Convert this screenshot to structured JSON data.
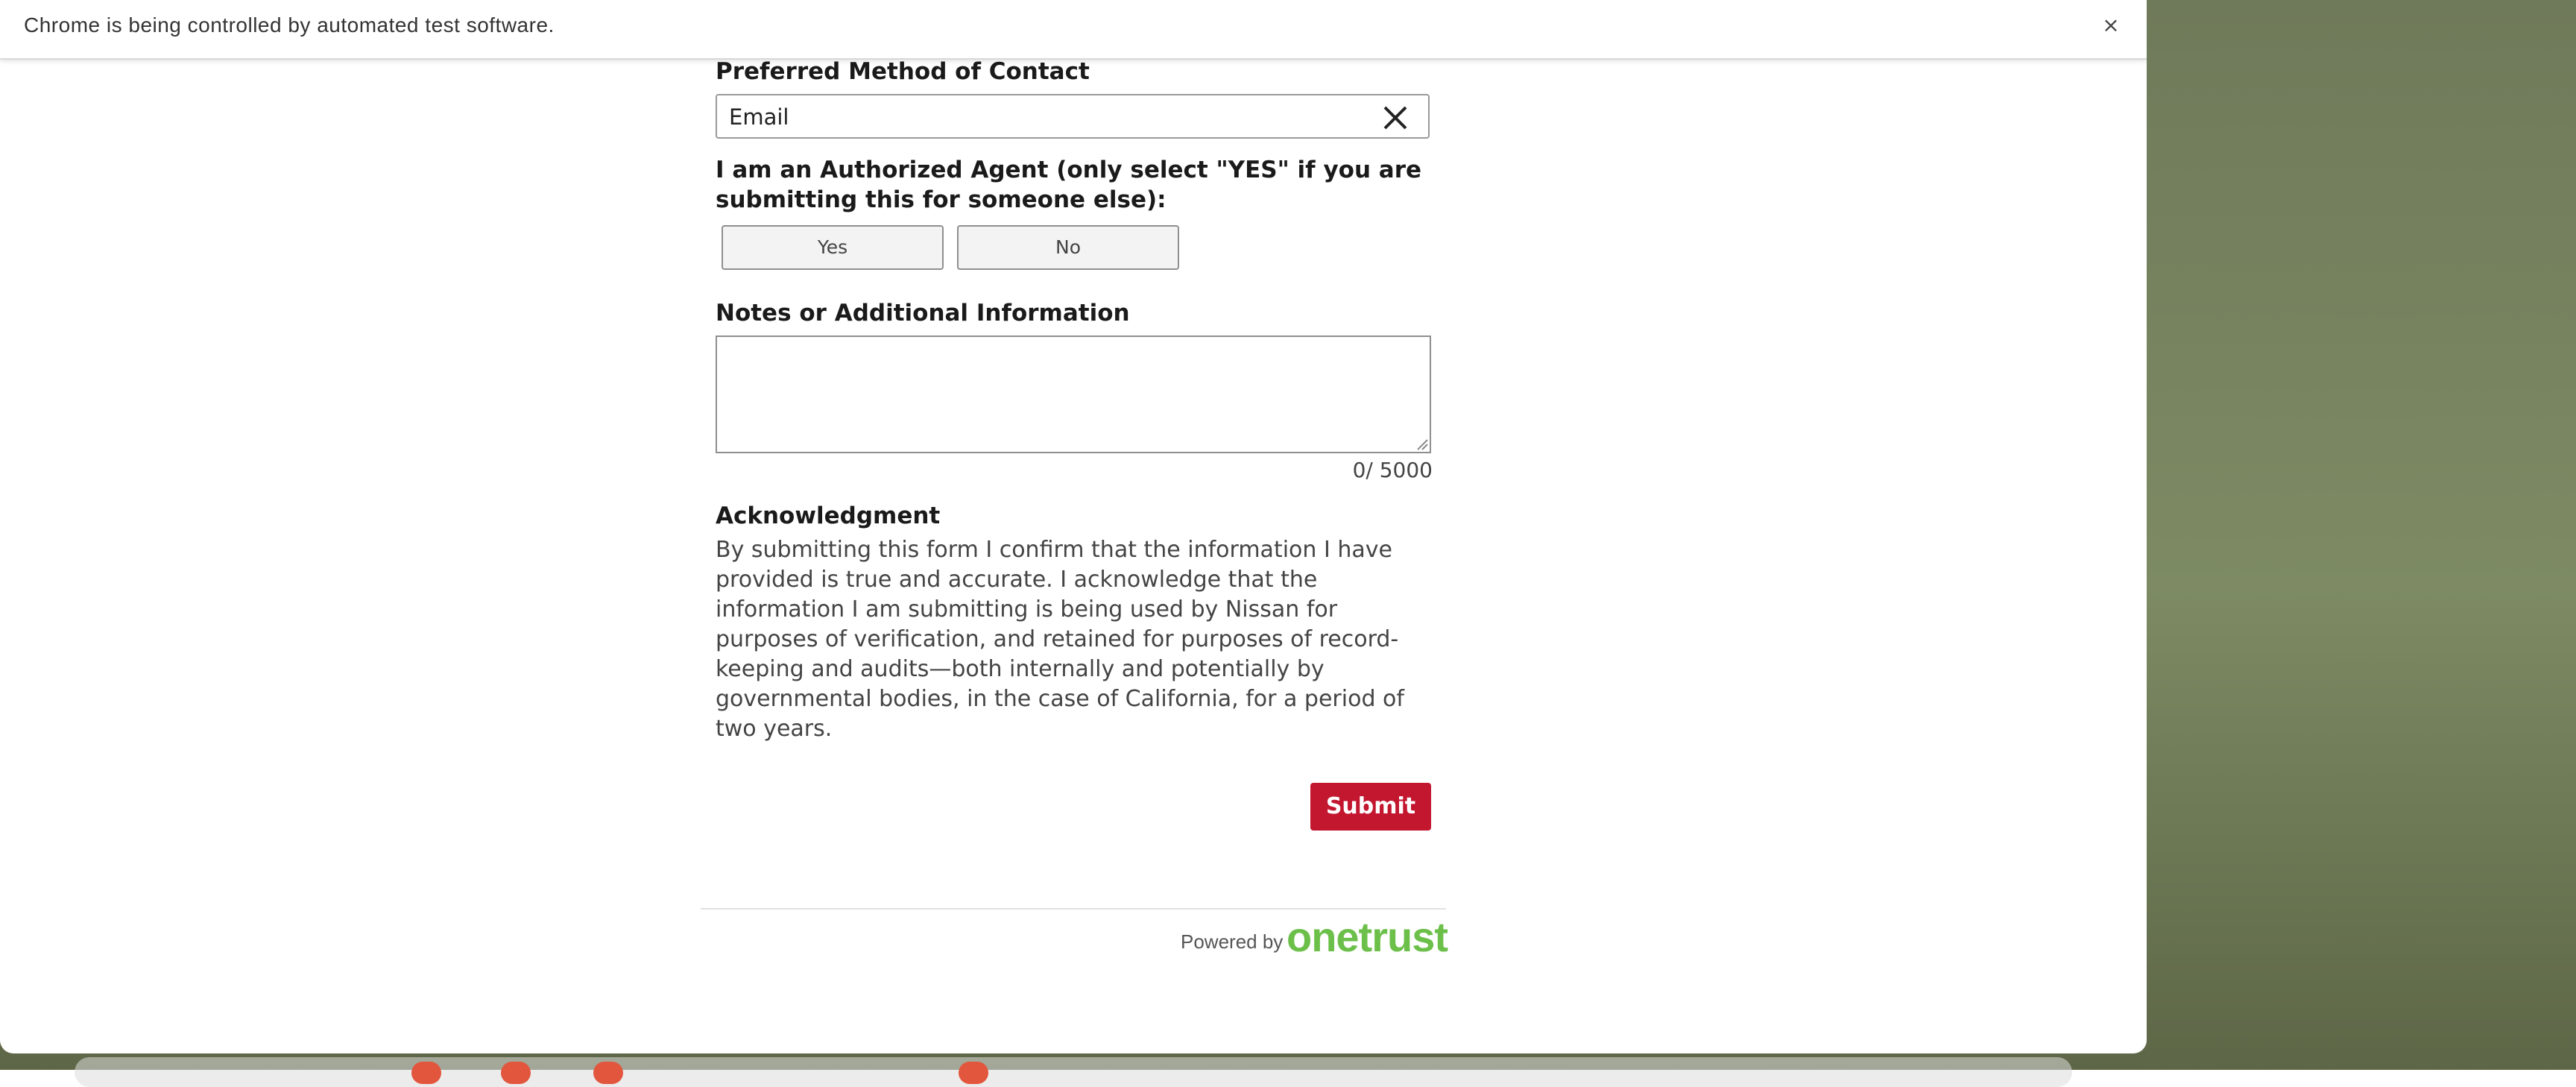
{
  "infobar": {
    "message": "Chrome is being controlled by automated test software.",
    "close_glyph": "×"
  },
  "form": {
    "contact_method": {
      "label": "Preferred Method of Contact",
      "selected_value": "Email"
    },
    "authorized_agent": {
      "label": "I am an Authorized Agent (only select \"YES\" if you are submitting this for someone else):",
      "options": [
        "Yes",
        "No"
      ]
    },
    "notes": {
      "label": "Notes or Additional Information",
      "value": "",
      "counter": "0/ 5000"
    },
    "acknowledgment": {
      "title": "Acknowledgment",
      "text": "By submitting this form I confirm that the information I have provided is true and accurate. I acknowledge that the information I am submitting is being used by Nissan for purposes of verification, and retained for purposes of record-keeping and audits—both internally and potentially by governmental bodies, in the case of California, for a period of two years."
    },
    "submit_label": "Submit",
    "submit_color": "#c3162f"
  },
  "footer": {
    "powered_by": "Powered by",
    "brand": "onetrust",
    "brand_color": "#6cc04a"
  },
  "icons": {
    "clear": "close-icon",
    "infobar_close": "close-icon"
  }
}
